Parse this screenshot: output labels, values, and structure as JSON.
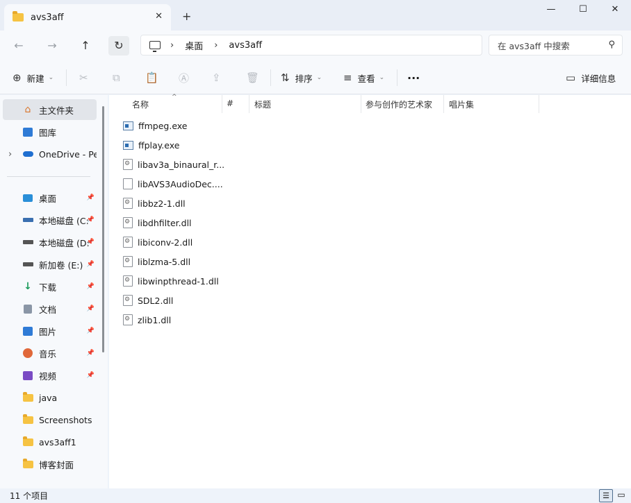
{
  "titlebar": {
    "tab_title": "avs3aff",
    "tab_close": "✕",
    "new_tab": "+",
    "minimize": "—",
    "maximize": "☐",
    "close": "✕"
  },
  "nav": {
    "back": "←",
    "forward": "→",
    "up": "↑",
    "refresh": "↻"
  },
  "address": {
    "sep": "›",
    "breadcrumbs": [
      "桌面",
      "avs3aff"
    ]
  },
  "search": {
    "placeholder": "在 avs3aff 中搜索",
    "icon": "⚲"
  },
  "toolbar": {
    "new_label": "新建",
    "new_icon": "⊕",
    "cut_icon": "✂",
    "copy_icon": "⧉",
    "paste_icon": "📋",
    "rename_icon": "Ⓐ",
    "share_icon": "⇪",
    "delete_icon": "🗑",
    "sort_label": "排序",
    "sort_icon": "⇅",
    "view_label": "查看",
    "view_icon": "≡",
    "more": "···",
    "details_label": "详细信息",
    "details_icon": "▭",
    "caret": "⌄"
  },
  "sidebar": {
    "home": "主文件夹",
    "gallery": "图库",
    "onedrive": "OneDrive - Per",
    "expand": "›",
    "pin": "📌",
    "quick": [
      {
        "label": "桌面",
        "pinned": true
      },
      {
        "label": "本地磁盘 (C:",
        "pinned": true
      },
      {
        "label": "本地磁盘 (D:",
        "pinned": true
      },
      {
        "label": "新加卷 (E:)",
        "pinned": true
      },
      {
        "label": "下载",
        "pinned": true
      },
      {
        "label": "文档",
        "pinned": true
      },
      {
        "label": "图片",
        "pinned": true
      },
      {
        "label": "音乐",
        "pinned": true
      },
      {
        "label": "视频",
        "pinned": true
      },
      {
        "label": "java",
        "pinned": false
      },
      {
        "label": "Screenshots",
        "pinned": false
      },
      {
        "label": "avs3aff1",
        "pinned": false
      },
      {
        "label": "博客封面",
        "pinned": false
      }
    ]
  },
  "columns": {
    "name": "名称",
    "number": "#",
    "title": "标题",
    "artists": "参与创作的艺术家",
    "album": "唱片集",
    "sort_caret": "^"
  },
  "files": [
    {
      "name": "ffmpeg.exe",
      "type": "exe"
    },
    {
      "name": "ffplay.exe",
      "type": "exe"
    },
    {
      "name": "libav3a_binaural_r...",
      "type": "dll"
    },
    {
      "name": "libAVS3AudioDec....",
      "type": "blank"
    },
    {
      "name": "libbz2-1.dll",
      "type": "dll"
    },
    {
      "name": "libdhfilter.dll",
      "type": "dll"
    },
    {
      "name": "libiconv-2.dll",
      "type": "dll"
    },
    {
      "name": "liblzma-5.dll",
      "type": "dll"
    },
    {
      "name": "libwinpthread-1.dll",
      "type": "dll"
    },
    {
      "name": "SDL2.dll",
      "type": "dll"
    },
    {
      "name": "zlib1.dll",
      "type": "dll"
    }
  ],
  "status": {
    "count": "11 个项目",
    "details_view_icon": "☰",
    "tiles_view_icon": "▭"
  },
  "colors": {
    "accent": "#2b6cb0",
    "folder": "#f6c343",
    "selected": "#e2e5ea"
  }
}
